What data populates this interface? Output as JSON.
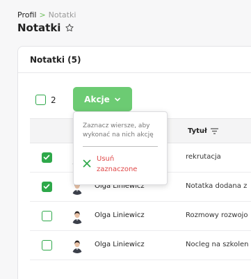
{
  "breadcrumb": {
    "items": [
      "Profil",
      "Notatki"
    ],
    "separator": ">"
  },
  "page": {
    "title": "Notatki"
  },
  "card": {
    "title": "Notatki (5)"
  },
  "selection": {
    "count": "2"
  },
  "actions": {
    "label": "Akcje"
  },
  "popover": {
    "hint": "Zaznacz wiersze, aby wykonać na nich akcję",
    "delete_label": "Usuń zaznaczone"
  },
  "table": {
    "columns": {
      "title": "Tytuł"
    },
    "rows": [
      {
        "name": "",
        "title": "rekrutacja",
        "checked": true
      },
      {
        "name": "Olga Liniewicz",
        "title": "Notatka dodana z",
        "checked": true
      },
      {
        "name": "Olga Liniewicz",
        "title": "Rozmowy rozwojo",
        "checked": false
      },
      {
        "name": "Olga Liniewicz",
        "title": "Nocleg na szkolen",
        "checked": false
      }
    ]
  },
  "colors": {
    "accent": "#2ea84a",
    "button": "#6ccb73",
    "danger": "#e04848"
  }
}
